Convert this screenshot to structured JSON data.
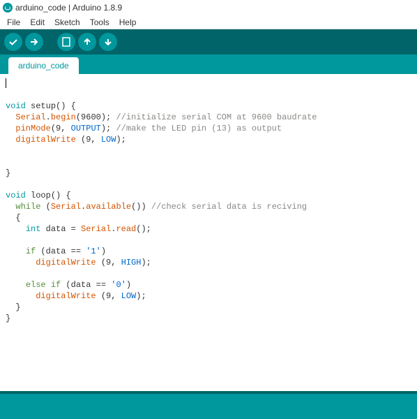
{
  "window": {
    "title": "arduino_code | Arduino 1.8.9"
  },
  "menu": {
    "file": "File",
    "edit": "Edit",
    "sketch": "Sketch",
    "tools": "Tools",
    "help": "Help"
  },
  "tab": {
    "name": "arduino_code"
  },
  "code": {
    "l1": "void",
    "l1b": " setup() {",
    "l2a": "  ",
    "l2b": "Serial",
    "l2c": ".",
    "l2d": "begin",
    "l2e": "(9600); ",
    "l2f": "//initialize serial COM at 9600 baudrate",
    "l3a": "  ",
    "l3b": "pinMode",
    "l3c": "(9, ",
    "l3d": "OUTPUT",
    "l3e": "); ",
    "l3f": "//make the LED pin (13) as output",
    "l4a": "  ",
    "l4b": "digitalWrite",
    "l4c": " (9, ",
    "l4d": "LOW",
    "l4e": ");",
    "l6": "}",
    "l8a": "void",
    "l8b": " loop() {",
    "l9a": "  ",
    "l9b": "while",
    "l9c": " (",
    "l9d": "Serial",
    "l9e": ".",
    "l9f": "available",
    "l9g": "()) ",
    "l9h": "//check serial data is reciving",
    "l10": "  {",
    "l11a": "    ",
    "l11b": "int",
    "l11c": " data = ",
    "l11d": "Serial",
    "l11e": ".",
    "l11f": "read",
    "l11g": "();",
    "l13a": "    ",
    "l13b": "if",
    "l13c": " (data == ",
    "l13d": "'1'",
    "l13e": ")",
    "l14a": "      ",
    "l14b": "digitalWrite",
    "l14c": " (9, ",
    "l14d": "HIGH",
    "l14e": ");",
    "l16a": "    ",
    "l16b": "else if",
    "l16c": " (data == ",
    "l16d": "'0'",
    "l16e": ")",
    "l17a": "      ",
    "l17b": "digitalWrite",
    "l17c": " (9, ",
    "l17d": "LOW",
    "l17e": ");",
    "l18": "  }",
    "l19": "}"
  }
}
